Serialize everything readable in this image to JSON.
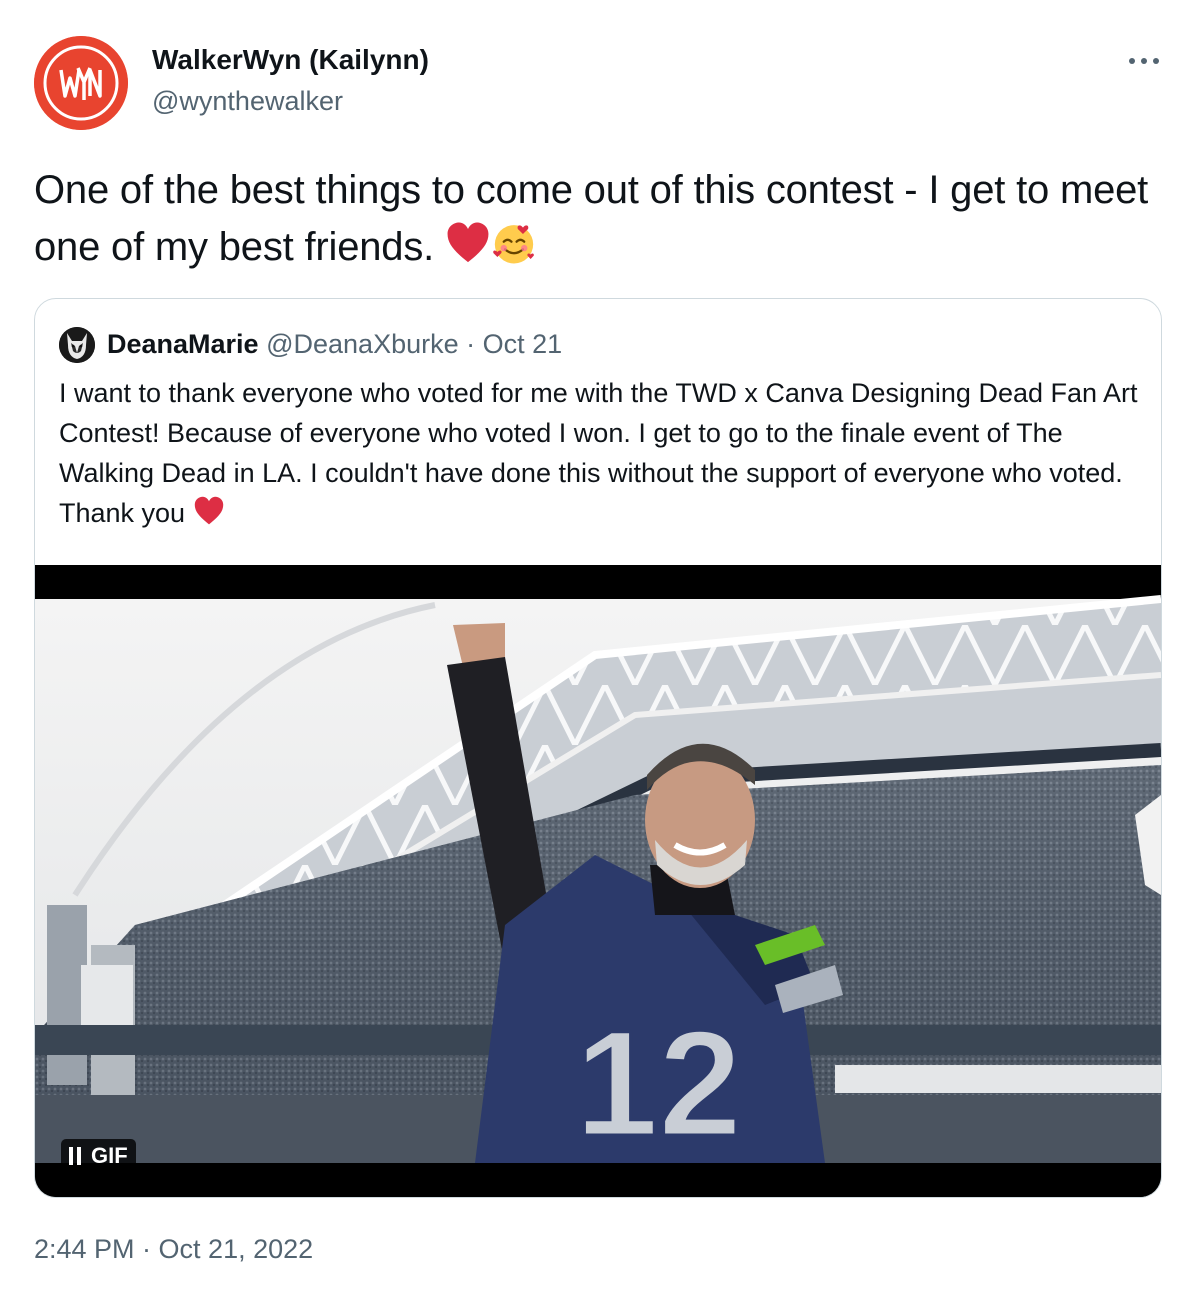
{
  "author": {
    "display_name": "WalkerWyn (Kailynn)",
    "handle": "@wynthewalker",
    "avatar_text": "WYN",
    "avatar_color": "#e8442f"
  },
  "tweet": {
    "text": "One of the best things to come out of this contest - I get to meet one of my best friends.",
    "emojis": [
      "red-heart",
      "smiling-face-with-hearts"
    ],
    "timestamp": "2:44 PM · Oct 21, 2022"
  },
  "quoted": {
    "display_name": "DeanaMarie",
    "handle": "@DeanaXburke",
    "separator": "·",
    "date": "Oct 21",
    "text": "I want to thank everyone who voted for me with the TWD x Canva Designing Dead Fan Art Contest! Because of everyone who voted I won. I get to go to the finale event of The Walking Dead in LA. I couldn't have done this without the support of everyone who voted. Thank you",
    "emoji": "red-heart",
    "media": {
      "type": "gif",
      "badge_label": "GIF",
      "jersey_number": "12"
    }
  },
  "colors": {
    "text": "#0f1419",
    "secondary": "#536471",
    "border": "#cfd9de",
    "heart": "#e0245e"
  },
  "icons": {
    "more": "ellipsis-icon",
    "pause": "pause-icon"
  }
}
